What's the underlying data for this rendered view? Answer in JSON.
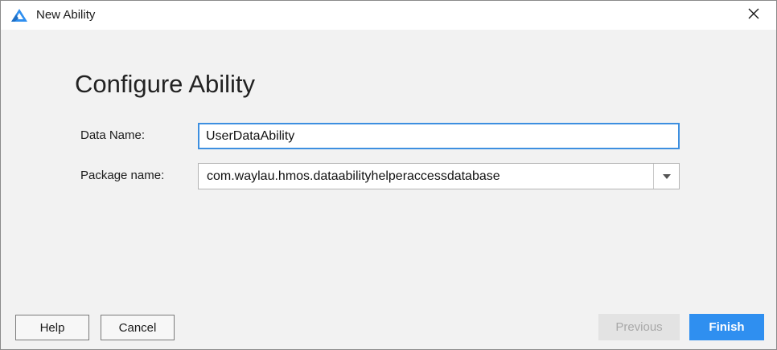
{
  "window": {
    "title": "New Ability",
    "app_icon": "app-logo-icon",
    "close_icon": "close-icon"
  },
  "page": {
    "heading": "Configure Ability"
  },
  "form": {
    "data_name_label": "Data Name:",
    "data_name_value": "UserDataAbility",
    "package_name_label": "Package name:",
    "package_name_value": "com.waylau.hmos.dataabilityhelperaccessdatabase",
    "package_dropdown_icon": "chevron-down-icon"
  },
  "footer": {
    "help_label": "Help",
    "cancel_label": "Cancel",
    "previous_label": "Previous",
    "finish_label": "Finish"
  },
  "colors": {
    "accent": "#2f8ff0",
    "focus_border": "#3d8fe0",
    "disabled_bg": "#e3e3e3",
    "disabled_text": "#a8a8a8",
    "background": "#f2f2f2"
  }
}
